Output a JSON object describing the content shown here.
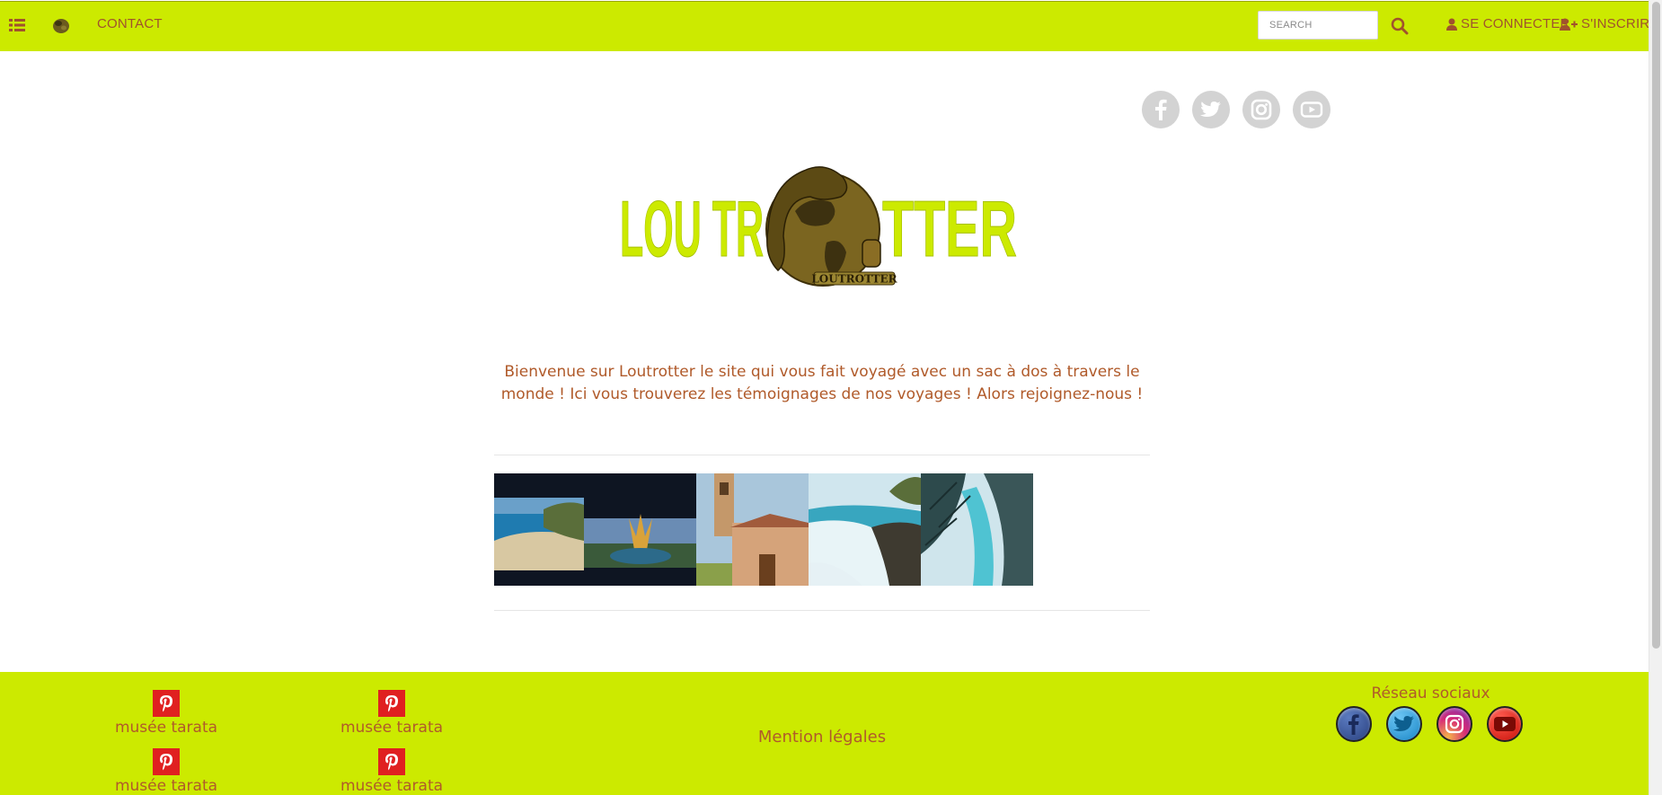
{
  "nav": {
    "contact_label": "CONTACT",
    "search_placeholder": "SEARCH",
    "login_label": "SE CONNECTER",
    "signup_label": "S'INSCRIRE"
  },
  "hero": {
    "logo_text_left": "LOU TR",
    "logo_text_right": "TTER",
    "logo_banner": "LOUTROTTER",
    "intro": "Bienvenue sur Loutrotter le site qui vous fait voyagé avec un sac à dos à travers le monde ! Ici vous trouverez les témoignages de nos voyages ! Alors rejoignez-nous !"
  },
  "social_top": [
    "facebook-icon",
    "twitter-icon",
    "instagram-icon",
    "youtube-icon"
  ],
  "gallery": {
    "photos": [
      "beach-photo",
      "cathedral-photo",
      "church-tower-photo",
      "coast-photo",
      "waterfall-photo"
    ]
  },
  "footer": {
    "pin_items": [
      {
        "label": "musée tarata"
      },
      {
        "label": "musée tarata"
      },
      {
        "label": "musée tarata"
      },
      {
        "label": "musée tarata"
      }
    ],
    "mention": "Mention légales",
    "social_title": "Réseau sociaux"
  },
  "colors": {
    "accent": "#ccea00",
    "text_brown": "#b05a2a",
    "pinterest_red": "#e02020",
    "facebook": "#3b5998",
    "twitter": "#1da1f2",
    "instagram": "#c13584",
    "youtube": "#e62117"
  }
}
